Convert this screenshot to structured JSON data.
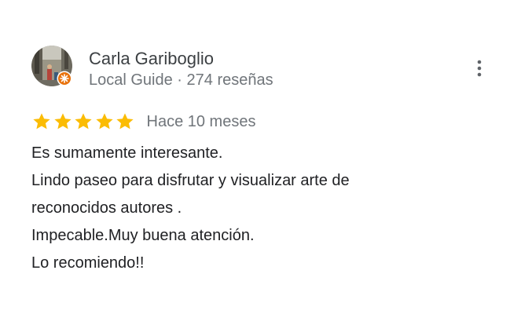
{
  "reviewer": {
    "name": "Carla Gariboglio",
    "meta": "Local Guide · 274 reseñas",
    "avatar_icon": "profile-photo",
    "badge_icon": "local-guide-badge-icon"
  },
  "menu": {
    "icon": "more-vert-icon"
  },
  "rating": {
    "stars": 5,
    "max_stars": 5,
    "star_color": "#fbbc04",
    "date": "Hace 10 meses"
  },
  "review": {
    "lines": [
      "Es sumamente interesante.",
      "Lindo paseo para disfrutar y visualizar arte de",
      "reconocidos autores .",
      "Impecable.Muy buena atención.",
      "Lo recomiendo!!"
    ]
  },
  "colors": {
    "name": "#3c4043",
    "meta": "#70757a",
    "body": "#202124",
    "badge": "#e8710a"
  }
}
